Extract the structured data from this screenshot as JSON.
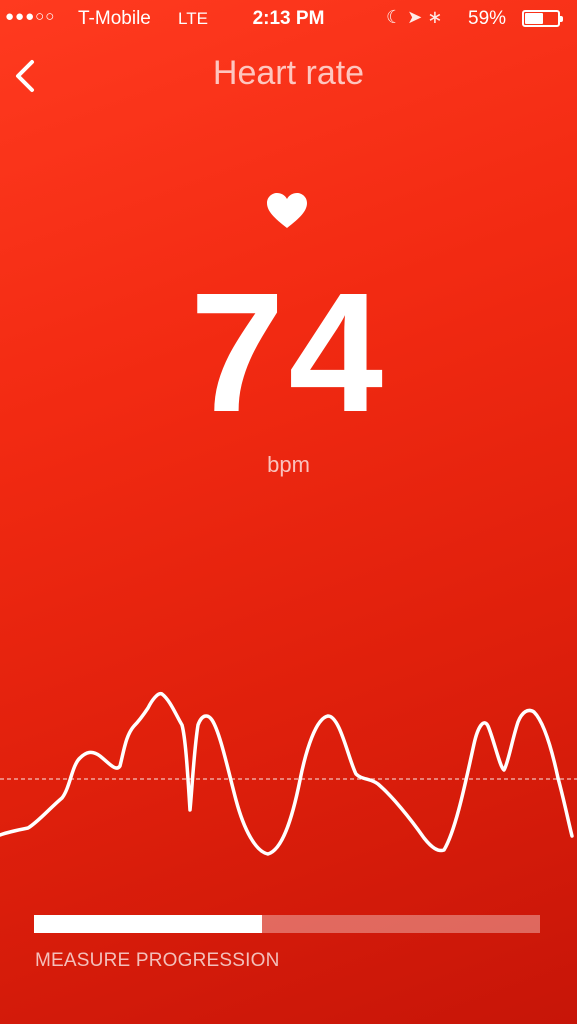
{
  "status_bar": {
    "signal": "●●●○○",
    "carrier": "T-Mobile",
    "network": "LTE",
    "time": "2:13 PM",
    "icons": "☾ ➤ ∗",
    "battery_percent": "59%",
    "battery_level": 0.59
  },
  "nav": {
    "back_icon": "chevron-left-icon",
    "title": "Heart rate"
  },
  "reading": {
    "heart_icon": "heart-icon",
    "value": "74",
    "unit": "bpm"
  },
  "progress": {
    "fraction": 0.45,
    "label": "MEASURE PROGRESSION"
  },
  "colors": {
    "background_top": "#ff3a1f",
    "background_bottom": "#c71508",
    "foreground": "#ffffff"
  }
}
